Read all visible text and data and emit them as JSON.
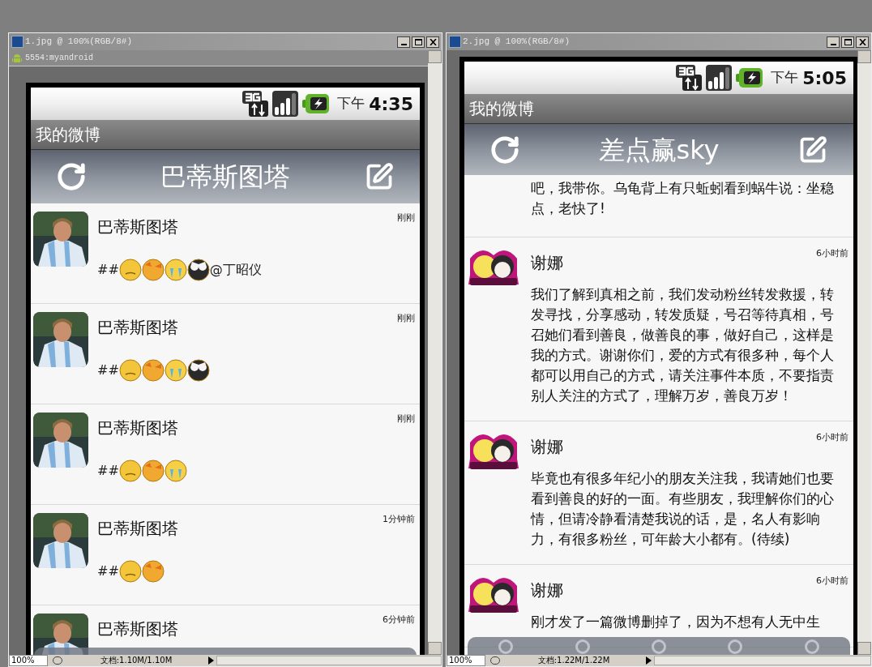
{
  "windows": [
    {
      "title": "1.jpg @ 100%(RGB/8#)",
      "subtitle": "5554:myandroid",
      "zoom": "100%",
      "doc_info": "文档:1.10M/1.10M",
      "phone": {
        "time_prefix": "下午",
        "time": "4:35",
        "app_title": "我的微博",
        "header_title": "巴蒂斯图塔",
        "posts": [
          {
            "name": "巴蒂斯图塔",
            "time": "刚刚",
            "text": "##",
            "emojis": [
              {
                "kind": "dizzy"
              },
              {
                "kind": "shy"
              },
              {
                "kind": "crying"
              },
              {
                "kind": "owl"
              }
            ],
            "suffix": "@丁昭仪"
          },
          {
            "name": "巴蒂斯图塔",
            "time": "刚刚",
            "text": "##",
            "emojis": [
              {
                "kind": "dizzy"
              },
              {
                "kind": "shy"
              },
              {
                "kind": "crying"
              },
              {
                "kind": "owl"
              }
            ]
          },
          {
            "name": "巴蒂斯图塔",
            "time": "刚刚",
            "text": "##",
            "emojis": [
              {
                "kind": "dizzy"
              },
              {
                "kind": "shy"
              },
              {
                "kind": "crying"
              }
            ]
          },
          {
            "name": "巴蒂斯图塔",
            "time": "1分钟前",
            "text": "##",
            "emojis": [
              {
                "kind": "dizzy"
              },
              {
                "kind": "shy"
              }
            ]
          },
          {
            "name": "巴蒂斯图塔",
            "time": "6分钟前"
          }
        ]
      }
    },
    {
      "title": "2.jpg @ 100%(RGB/8#)",
      "zoom": "100%",
      "doc_info": "文档:1.22M/1.22M",
      "phone": {
        "time_prefix": "下午",
        "time": "5:05",
        "app_title": "我的微博",
        "header_title": "差点赢sky",
        "partial_text": "吧，我带你。乌龟背上有只蚯蚓看到蜗牛说：坐稳点，老快了!",
        "posts": [
          {
            "kind": "cartoon",
            "name": "谢娜",
            "time": "6小时前",
            "text": "我们了解到真相之前，我们发动粉丝转发救援，转发寻找，分享感动，转发质疑，号召等待真相，号召她们看到善良，做善良的事，做好自己，这样是我的方式。谢谢你们，爱的方式有很多种，每个人都可以用自己的方式，请关注事件本质，不要指责别人关注的方式了，理解万岁，善良万岁！"
          },
          {
            "kind": "cartoon",
            "name": "谢娜",
            "time": "6小时前",
            "text": "毕竟也有很多年纪小的朋友关注我，我请她们也要看到善良的好的一面。有些朋友，我理解你们的心情，但请冷静看清楚我说的话，是，名人有影响力，有很多粉丝，可年龄大小都有。(待续)"
          },
          {
            "kind": "cartoon",
            "name": "谢娜",
            "time": "6小时前",
            "text": "刚才发了一篇微博删掉了，因为不想有人无中生"
          }
        ]
      }
    }
  ]
}
